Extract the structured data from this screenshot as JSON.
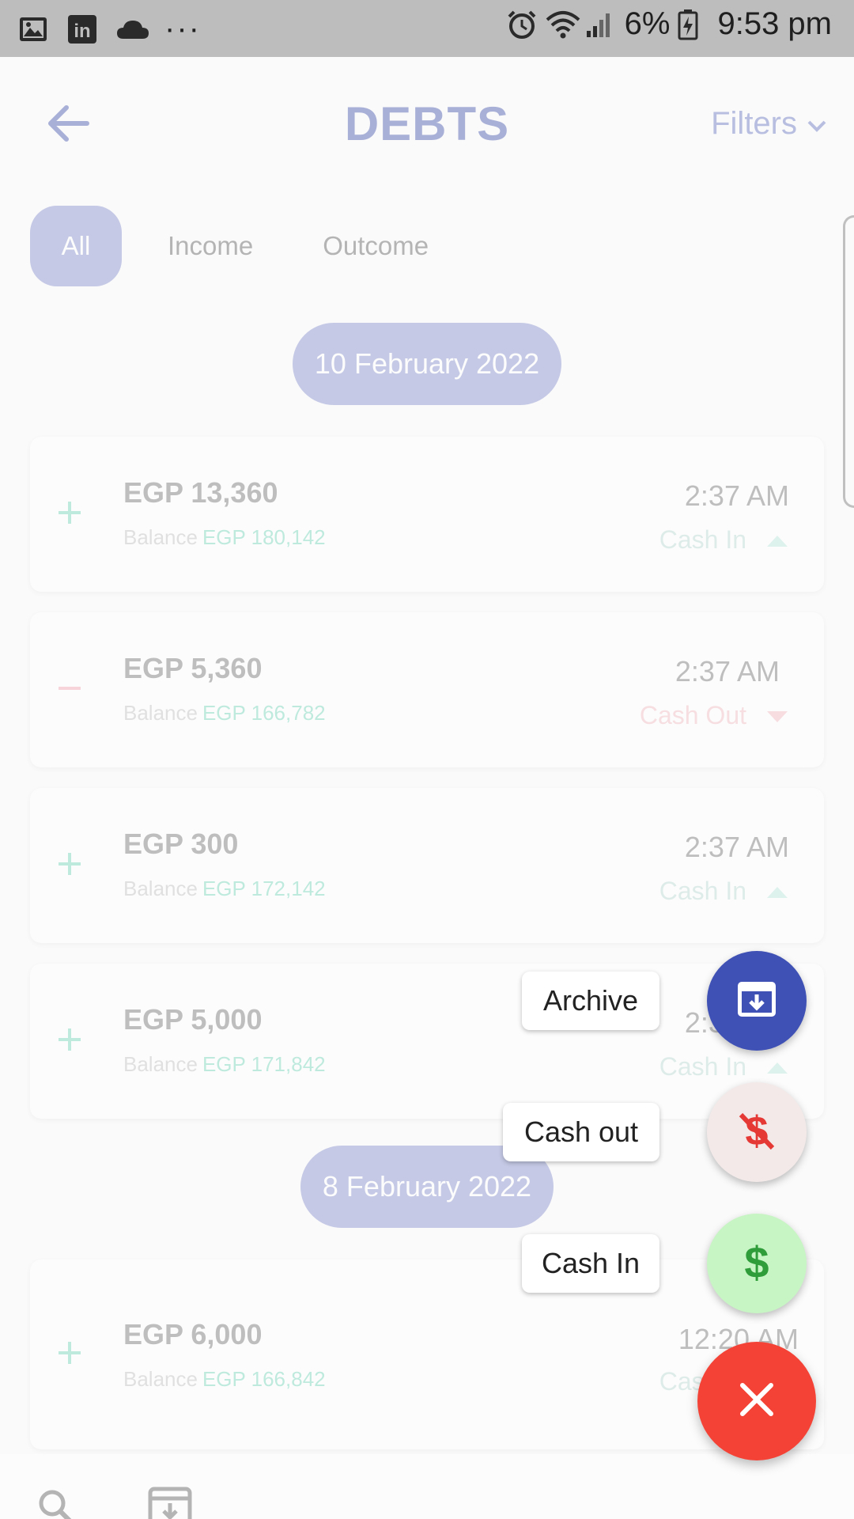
{
  "status_bar": {
    "icons_left": [
      "gallery-icon",
      "linkedin-icon",
      "cloud-icon",
      "more-dots-icon"
    ],
    "linkedin_text": "in",
    "dots": "···",
    "battery": "6%",
    "time": "9:53 pm"
  },
  "header": {
    "title": "DEBTS",
    "filters_label": "Filters"
  },
  "tabs": [
    {
      "label": "All",
      "active": true
    },
    {
      "label": "Income",
      "active": false
    },
    {
      "label": "Outcome",
      "active": false
    }
  ],
  "groups": [
    {
      "date": "10 February 2022",
      "items": [
        {
          "amount": "EGP 13,360",
          "balance_label": "Balance",
          "balance": "EGP 180,142",
          "time": "2:37 AM",
          "kind": "Cash In",
          "type": "in"
        },
        {
          "amount": "EGP 5,360",
          "balance_label": "Balance",
          "balance": "EGP 166,782",
          "time": "2:37 AM",
          "kind": "Cash Out",
          "type": "out"
        },
        {
          "amount": "EGP 300",
          "balance_label": "Balance",
          "balance": "EGP 172,142",
          "time": "2:37 AM",
          "kind": "Cash In",
          "type": "in"
        },
        {
          "amount": "EGP 5,000",
          "balance_label": "Balance",
          "balance": "EGP 171,842",
          "time": "2:37 AM",
          "kind": "Cash In",
          "type": "in"
        }
      ]
    },
    {
      "date": "8 February 2022",
      "items": [
        {
          "amount": "EGP 6,000",
          "balance_label": "Balance",
          "balance": "EGP 166,842",
          "time": "12:20 AM",
          "kind": "Cash In",
          "type": "in"
        }
      ]
    }
  ],
  "fab_menu": {
    "archive_label": "Archive",
    "cash_out_label": "Cash out",
    "cash_in_label": "Cash In"
  },
  "colors": {
    "primary": "#3f51b5",
    "close_fab": "#f44336",
    "cash_in_fab": "#c8f5c4",
    "cash_out_fab": "#f3e9e9",
    "income": "#6dd3b5",
    "outcome": "#f0b7bf"
  }
}
